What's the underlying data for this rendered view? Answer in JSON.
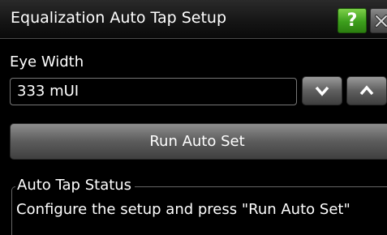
{
  "window": {
    "title": "Equalization Auto Tap Setup",
    "help_label": "?",
    "help_icon": "help-icon",
    "close_icon": "close-icon"
  },
  "eye_width": {
    "label": "Eye Width",
    "value": "333 mUI",
    "decrement_icon": "chevron-down-icon",
    "increment_icon": "chevron-up-icon"
  },
  "run_button": {
    "label": "Run Auto Set"
  },
  "status": {
    "title": "Auto Tap Status",
    "message": "Configure the setup and press \"Run Auto Set\""
  },
  "colors": {
    "background": "#000000",
    "help_green": "#3c9e1c",
    "button_gray": "#5c5c5c"
  }
}
